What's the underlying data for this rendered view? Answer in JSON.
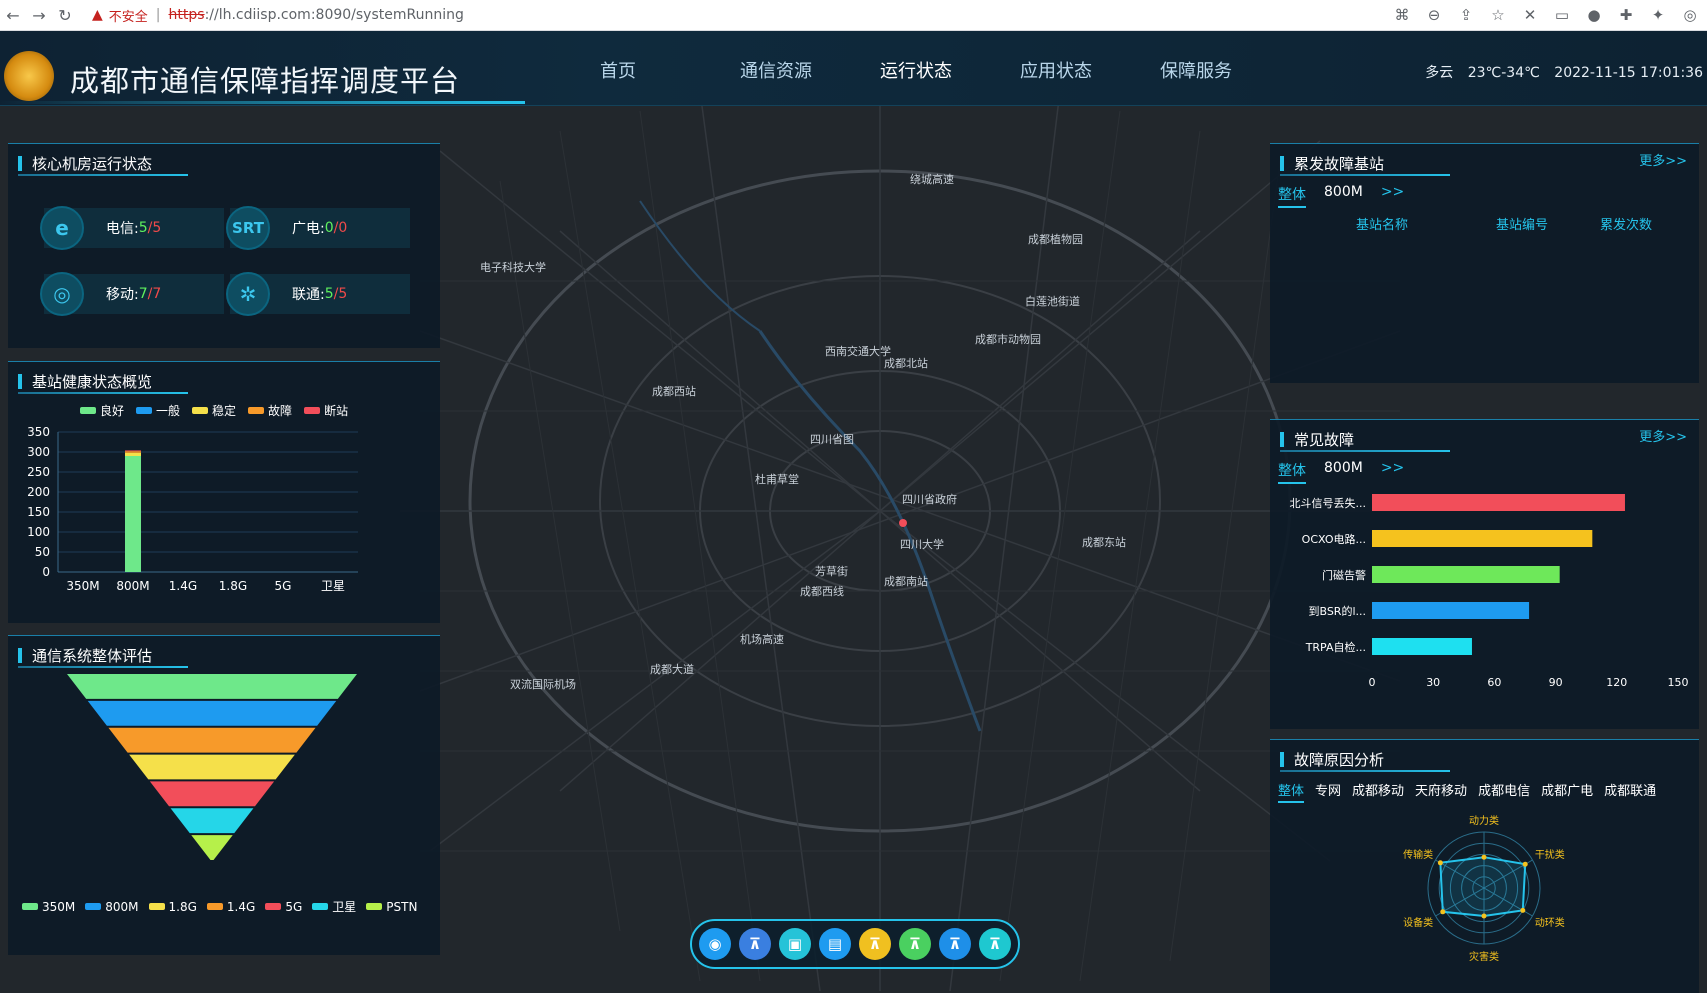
{
  "browser": {
    "security_warning": "不安全",
    "url_scheme": "https",
    "url_rest": "://lh.cdiisp.com:8090/systemRunning"
  },
  "header": {
    "title": "成都市通信保障指挥调度平台",
    "nav": [
      "首页",
      "通信资源",
      "运行状态",
      "应用状态",
      "保障服务"
    ],
    "active_nav": "运行状态",
    "weather": "多云",
    "temperature": "23℃-34℃",
    "datetime": "2022-11-15 17:01:36"
  },
  "core_room": {
    "title": "核心机房运行状态",
    "items": [
      {
        "icon": "telecom-icon",
        "icon_text": "e",
        "label": "电信:",
        "value": "5",
        "total": "5"
      },
      {
        "icon": "srt-icon",
        "icon_text": "SRT",
        "label": "广电:",
        "value": "0",
        "total": "0"
      },
      {
        "icon": "mobile-icon",
        "icon_text": "◎",
        "label": "移动:",
        "value": "7",
        "total": "7"
      },
      {
        "icon": "unicom-icon",
        "icon_text": "✲",
        "label": "联通:",
        "value": "5",
        "total": "5"
      }
    ]
  },
  "station_health": {
    "title": "基站健康状态概览",
    "legend": [
      {
        "name": "良好",
        "color": "#6ee88a"
      },
      {
        "name": "一般",
        "color": "#1e9bf0"
      },
      {
        "name": "稳定",
        "color": "#f5e04a"
      },
      {
        "name": "故障",
        "color": "#f79a2a"
      },
      {
        "name": "断站",
        "color": "#f24e5a"
      }
    ],
    "chart_data": {
      "type": "bar",
      "stacked": true,
      "categories": [
        "350M",
        "800M",
        "1.4G",
        "1.8G",
        "5G",
        "卫星"
      ],
      "series": [
        {
          "name": "良好",
          "values": [
            0,
            290,
            0,
            0,
            0,
            0
          ]
        },
        {
          "name": "一般",
          "values": [
            0,
            0,
            0,
            0,
            0,
            0
          ]
        },
        {
          "name": "稳定",
          "values": [
            0,
            8,
            0,
            0,
            0,
            0
          ]
        },
        {
          "name": "故障",
          "values": [
            0,
            4,
            0,
            0,
            0,
            0
          ]
        },
        {
          "name": "断站",
          "values": [
            0,
            2,
            0,
            0,
            0,
            0
          ]
        }
      ],
      "yticks": [
        0,
        50,
        100,
        150,
        200,
        250,
        300,
        350
      ],
      "ylim": [
        0,
        350
      ]
    }
  },
  "evaluation": {
    "title": "通信系统整体评估",
    "layers": [
      {
        "name": "350M",
        "color": "#6ee88a"
      },
      {
        "name": "800M",
        "color": "#1e9bf0"
      },
      {
        "name": "1.8G",
        "color": "#f79a2a"
      },
      {
        "name": "1.4G",
        "color": "#f5e04a"
      },
      {
        "name": "5G",
        "color": "#f24e5a"
      },
      {
        "name": "卫星",
        "color": "#25d6e8"
      },
      {
        "name": "PSTN",
        "color": "#b6f04a"
      }
    ],
    "legend": [
      {
        "name": "350M",
        "color": "#6ee88a"
      },
      {
        "name": "800M",
        "color": "#1e9bf0"
      },
      {
        "name": "1.8G",
        "color": "#f5e04a"
      },
      {
        "name": "1.4G",
        "color": "#f79a2a"
      },
      {
        "name": "5G",
        "color": "#f24e5a"
      },
      {
        "name": "卫星",
        "color": "#25d6e8"
      },
      {
        "name": "PSTN",
        "color": "#b6f04a"
      }
    ]
  },
  "burst_fault": {
    "title": "累发故障基站",
    "more": "更多>>",
    "tabs": [
      "整体",
      "800M"
    ],
    "arrow": ">>",
    "columns": [
      "基站名称",
      "基站编号",
      "累发次数"
    ]
  },
  "common_fault": {
    "title": "常见故障",
    "more": "更多>>",
    "tabs": [
      "整体",
      "800M"
    ],
    "arrow": ">>",
    "chart_data": {
      "type": "bar",
      "orientation": "horizontal",
      "categories": [
        "北斗信号丢失...",
        "OCXO电路...",
        "门磁告警",
        "到BSR的l...",
        "TRPA自检..."
      ],
      "values": [
        124,
        108,
        92,
        77,
        49
      ],
      "colors": [
        "#f24e5a",
        "#f5c21e",
        "#6ee85a",
        "#1e9bf0",
        "#1ee0f0"
      ],
      "xticks": [
        0,
        30,
        60,
        90,
        120,
        150
      ],
      "xlim": [
        0,
        150
      ]
    }
  },
  "fault_cause": {
    "title": "故障原因分析",
    "tabs": [
      "整体",
      "专网",
      "成都移动",
      "天府移动",
      "成都电信",
      "成都广电",
      "成都联通"
    ],
    "chart_data": {
      "type": "radar",
      "axes": [
        "动力类",
        "干扰类",
        "动环类",
        "灾害类",
        "设备类",
        "传输类"
      ],
      "values": [
        0.55,
        0.85,
        0.8,
        0.5,
        0.85,
        0.9
      ],
      "rings": 5
    }
  },
  "map": {
    "labels": [
      {
        "text": "绕城高速",
        "x": 910,
        "y": 140
      },
      {
        "text": "成都植物园",
        "x": 1028,
        "y": 200
      },
      {
        "text": "电子科技大学",
        "x": 480,
        "y": 228
      },
      {
        "text": "白莲池街道",
        "x": 1025,
        "y": 262
      },
      {
        "text": "成都市动物园",
        "x": 975,
        "y": 300
      },
      {
        "text": "西南交通大学",
        "x": 825,
        "y": 312
      },
      {
        "text": "成都北站",
        "x": 884,
        "y": 324
      },
      {
        "text": "成都西站",
        "x": 652,
        "y": 352
      },
      {
        "text": "四川省图",
        "x": 810,
        "y": 400
      },
      {
        "text": "杜甫草堂",
        "x": 755,
        "y": 440
      },
      {
        "text": "四川省政府",
        "x": 902,
        "y": 460
      },
      {
        "text": "四川大学",
        "x": 900,
        "y": 505
      },
      {
        "text": "成都东站",
        "x": 1082,
        "y": 503
      },
      {
        "text": "芳草街",
        "x": 815,
        "y": 532
      },
      {
        "text": "成都南站",
        "x": 884,
        "y": 542
      },
      {
        "text": "成都西线",
        "x": 800,
        "y": 552
      },
      {
        "text": "双流国际机场",
        "x": 510,
        "y": 645
      },
      {
        "text": "机场高速",
        "x": 740,
        "y": 600
      },
      {
        "text": "成都大道",
        "x": 650,
        "y": 630
      }
    ]
  },
  "toolbar": {
    "tools": [
      {
        "icon": "gear-target-icon",
        "glyph": "◉",
        "color": "#1e9bf0"
      },
      {
        "icon": "tower-icon",
        "glyph": "⊼",
        "color": "#3a7fe0"
      },
      {
        "icon": "monitor-icon",
        "glyph": "▣",
        "color": "#25c3d8"
      },
      {
        "icon": "book-icon",
        "glyph": "▤",
        "color": "#1e9bf0"
      },
      {
        "icon": "tower-yellow-icon",
        "glyph": "⊼",
        "color": "#f0c020"
      },
      {
        "icon": "tower-green-icon",
        "glyph": "⊼",
        "color": "#4ad060"
      },
      {
        "icon": "tower-blue-icon",
        "glyph": "⊼",
        "color": "#1e8fe8"
      },
      {
        "icon": "tower-teal-icon",
        "glyph": "⊼",
        "color": "#1ec8d0"
      }
    ]
  }
}
